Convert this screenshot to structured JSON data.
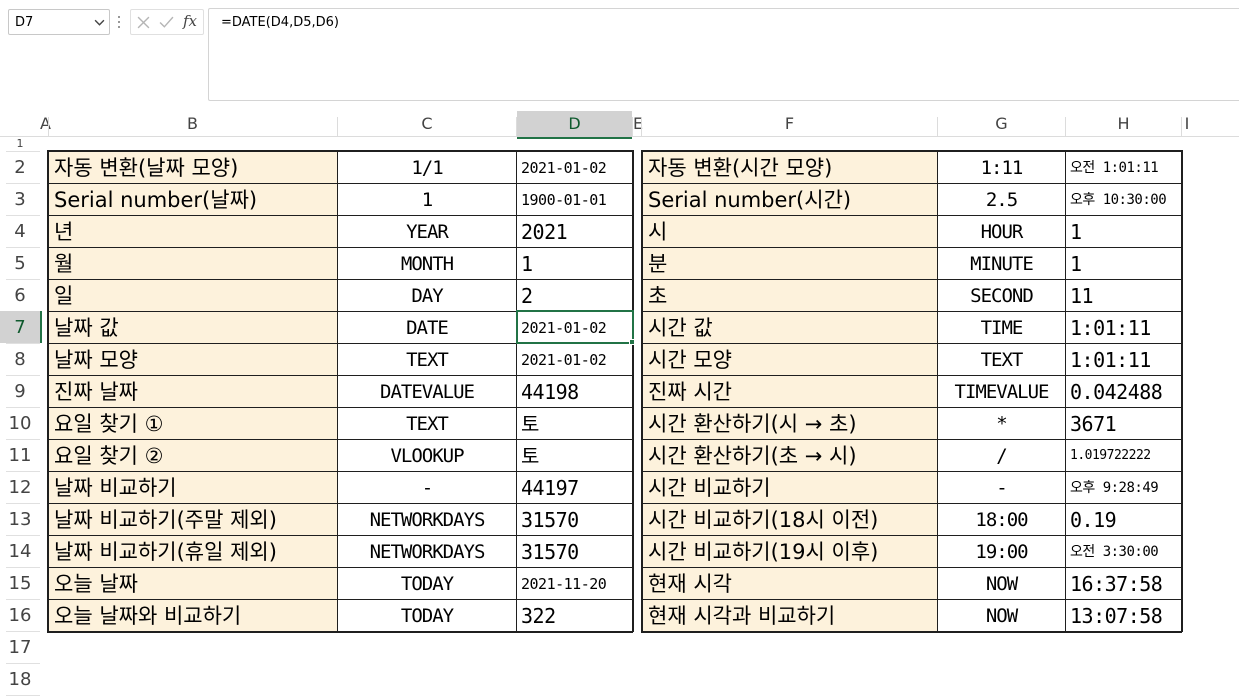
{
  "name_box": {
    "value": "D7"
  },
  "formula_bar": {
    "formula": "=DATE(D4,D5,D6)",
    "fx_label": "fx"
  },
  "columns": [
    "A",
    "B",
    "C",
    "D",
    "E",
    "F",
    "G",
    "H",
    "I"
  ],
  "rows": [
    "1",
    "2",
    "3",
    "4",
    "5",
    "6",
    "7",
    "8",
    "9",
    "10",
    "11",
    "12",
    "13",
    "14",
    "15",
    "16",
    "17",
    "18"
  ],
  "table": {
    "date": [
      {
        "label": "자동 변환(날짜 모양)",
        "func": "1/1",
        "value": "2021-01-02"
      },
      {
        "label": "Serial number(날짜)",
        "func": "1",
        "value": "1900-01-01"
      },
      {
        "label": "년",
        "func": "YEAR",
        "value": "2021"
      },
      {
        "label": "월",
        "func": "MONTH",
        "value": "1"
      },
      {
        "label": "일",
        "func": "DAY",
        "value": "2"
      },
      {
        "label": "날짜 값",
        "func": "DATE",
        "value": "2021-01-02"
      },
      {
        "label": "날짜 모양",
        "func": "TEXT",
        "value": "2021-01-02"
      },
      {
        "label": "진짜 날짜",
        "func": "DATEVALUE",
        "value": "44198"
      },
      {
        "label": "요일 찾기 ①",
        "func": "TEXT",
        "value": "토"
      },
      {
        "label": "요일 찾기 ②",
        "func": "VLOOKUP",
        "value": "토"
      },
      {
        "label": "날짜 비교하기",
        "func": "-",
        "value": "44197"
      },
      {
        "label": "날짜 비교하기(주말 제외)",
        "func": "NETWORKDAYS",
        "value": "31570"
      },
      {
        "label": "날짜 비교하기(휴일 제외)",
        "func": "NETWORKDAYS",
        "value": "31570"
      },
      {
        "label": "오늘 날짜",
        "func": "TODAY",
        "value": "2021-11-20"
      },
      {
        "label": "오늘 날짜와 비교하기",
        "func": "TODAY",
        "value": "322"
      }
    ],
    "time": [
      {
        "label": "자동 변환(시간 모양)",
        "func": "1:11",
        "value": "오전 1:01:11"
      },
      {
        "label": "Serial number(시간)",
        "func": "2.5",
        "value": "오후 10:30:00"
      },
      {
        "label": "시",
        "func": "HOUR",
        "value": "1"
      },
      {
        "label": "분",
        "func": "MINUTE",
        "value": "1"
      },
      {
        "label": "초",
        "func": "SECOND",
        "value": "11"
      },
      {
        "label": "시간 값",
        "func": "TIME",
        "value": "1:01:11"
      },
      {
        "label": "시간 모양",
        "func": "TEXT",
        "value": "1:01:11"
      },
      {
        "label": "진짜 시간",
        "func": "TIMEVALUE",
        "value": "0.042488"
      },
      {
        "label": "시간 환산하기(시 → 초)",
        "func": "*",
        "value": "3671"
      },
      {
        "label": "시간 환산하기(초 → 시)",
        "func": "/",
        "value": "1.019722222"
      },
      {
        "label": "시간 비교하기",
        "func": "-",
        "value": "오후 9:28:49"
      },
      {
        "label": "시간 비교하기(18시 이전)",
        "func": "18:00",
        "value": "0.19"
      },
      {
        "label": "시간 비교하기(19시 이후)",
        "func": "19:00",
        "value": "오전 3:30:00"
      },
      {
        "label": "현재 시각",
        "func": "NOW",
        "value": "16:37:58"
      },
      {
        "label": "현재 시각과 비교하기",
        "func": "NOW",
        "value": "13:07:58"
      }
    ]
  },
  "selection": {
    "cell": "D7"
  },
  "colors": {
    "label_fill": "#fdf2dc",
    "selection": "#217346",
    "header_active": "#d2d2d2"
  }
}
